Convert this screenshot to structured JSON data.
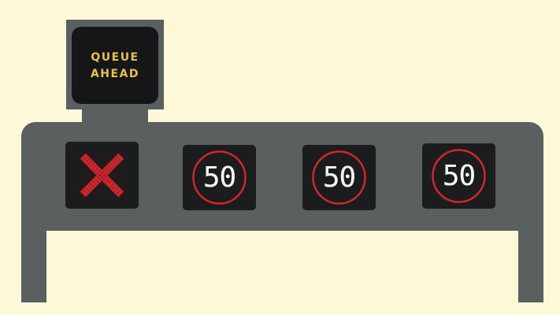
{
  "vms": {
    "line1": "QUEUE",
    "line2": "AHEAD",
    "text_color": "#e8c34a"
  },
  "lanes": [
    {
      "type": "closed",
      "symbol": "red-x-icon",
      "color": "#d1262b"
    },
    {
      "type": "speed-limit",
      "value": "50",
      "ring_color": "#d1262b"
    },
    {
      "type": "speed-limit",
      "value": "50",
      "ring_color": "#d1262b"
    },
    {
      "type": "speed-limit",
      "value": "50",
      "ring_color": "#d1262b"
    }
  ],
  "colors": {
    "background": "#fdf8d8",
    "gantry": "#5a5f60",
    "panel": "#1b1c1d"
  }
}
